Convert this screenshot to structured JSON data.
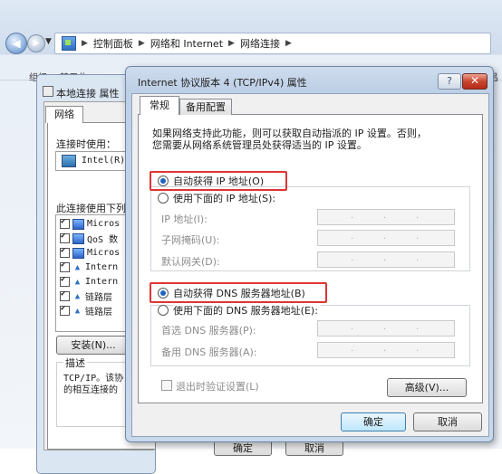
{
  "explorer": {
    "breadcrumbs": [
      "控制面板",
      "网络和 Internet",
      "网络连接"
    ],
    "toolbar_left": "组织 ▼     禁用此",
    "toolbar_right": "吕"
  },
  "local_conn": {
    "title": "本地连接 属性",
    "tab": "网络",
    "connect_using_label": "连接时使用：",
    "adapter": "Intel(R)",
    "uses_label": "此连接使用下列",
    "items": [
      "Micros",
      "QoS 数",
      "Micros",
      "Intern",
      "Intern",
      "链路层",
      "链路层"
    ],
    "install_button": "安装(N)...",
    "desc_title": "描述",
    "desc_line1": "TCP/IP。该协",
    "desc_line2": "的相互连接的",
    "ok_button": "确定",
    "cancel_button": "取消"
  },
  "dialog": {
    "title": "Internet 协议版本 4 (TCP/IPv4) 属性",
    "help_label": "?",
    "close_label": "✕",
    "tabs": [
      "常规",
      "备用配置"
    ],
    "intro_line1": "如果网络支持此功能，则可以获取自动指派的 IP 设置。否则，",
    "intro_line2": "您需要从网络系统管理员处获得适当的 IP 设置。",
    "auto_ip_label": "自动获得 IP 地址(O)",
    "manual_ip_label": "使用下面的 IP 地址(S):",
    "ip_label": "IP 地址(I):",
    "mask_label": "子网掩码(U):",
    "gateway_label": "默认网关(D):",
    "auto_dns_label": "自动获得 DNS 服务器地址(B)",
    "manual_dns_label": "使用下面的 DNS 服务器地址(E):",
    "pref_dns_label": "首选 DNS 服务器(P):",
    "alt_dns_label": "备用 DNS 服务器(A):",
    "ip_dot": ".",
    "validate_label": "退出时验证设置(L)",
    "advanced_button": "高级(V)...",
    "ok_button": "确定",
    "cancel_button": "取消",
    "auto_ip_selected": true,
    "auto_dns_selected": true
  },
  "colors": {
    "highlight_box": "#e03434",
    "radio_dot": "#1c62c4",
    "close_button": "#c9452f"
  }
}
